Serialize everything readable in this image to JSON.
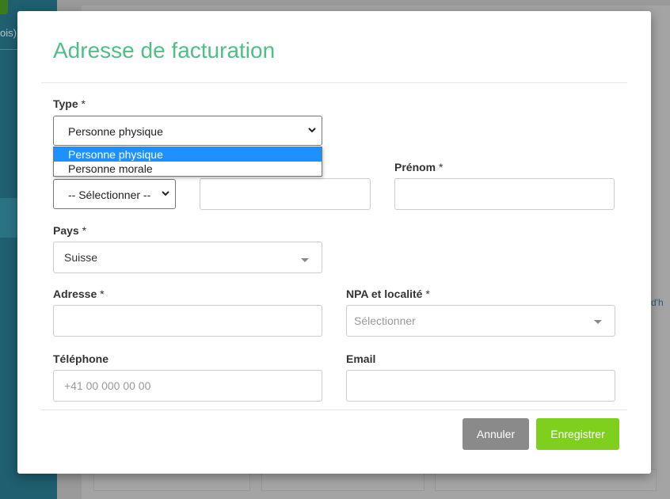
{
  "background": {
    "left_fragment": "ois)",
    "right_fragment": "rd'h"
  },
  "modal": {
    "title": "Adresse de facturation",
    "type": {
      "label": "Type",
      "required_mark": "*",
      "value": "Personne physique",
      "options": [
        "Personne physique",
        "Personne morale"
      ],
      "highlighted_option": "Personne physique"
    },
    "civilite": {
      "value": "-- Sélectionner --"
    },
    "nom": {
      "value": ""
    },
    "prenom": {
      "label": "Prénom",
      "required_mark": "*",
      "value": ""
    },
    "pays": {
      "label": "Pays",
      "required_mark": "*",
      "value": "Suisse"
    },
    "adresse": {
      "label": "Adresse",
      "required_mark": "*",
      "value": ""
    },
    "npa": {
      "label": "NPA et localité",
      "required_mark": "*",
      "placeholder": "Sélectionner"
    },
    "telephone": {
      "label": "Téléphone",
      "placeholder": "+41 00 000 00 00"
    },
    "email": {
      "label": "Email",
      "value": ""
    },
    "buttons": {
      "cancel": "Annuler",
      "save": "Enregistrer"
    }
  },
  "colors": {
    "title": "#4fbf88",
    "save_button": "#7fcf1f",
    "cancel_button": "#8a8a8a",
    "option_highlight": "#1e90ff"
  }
}
